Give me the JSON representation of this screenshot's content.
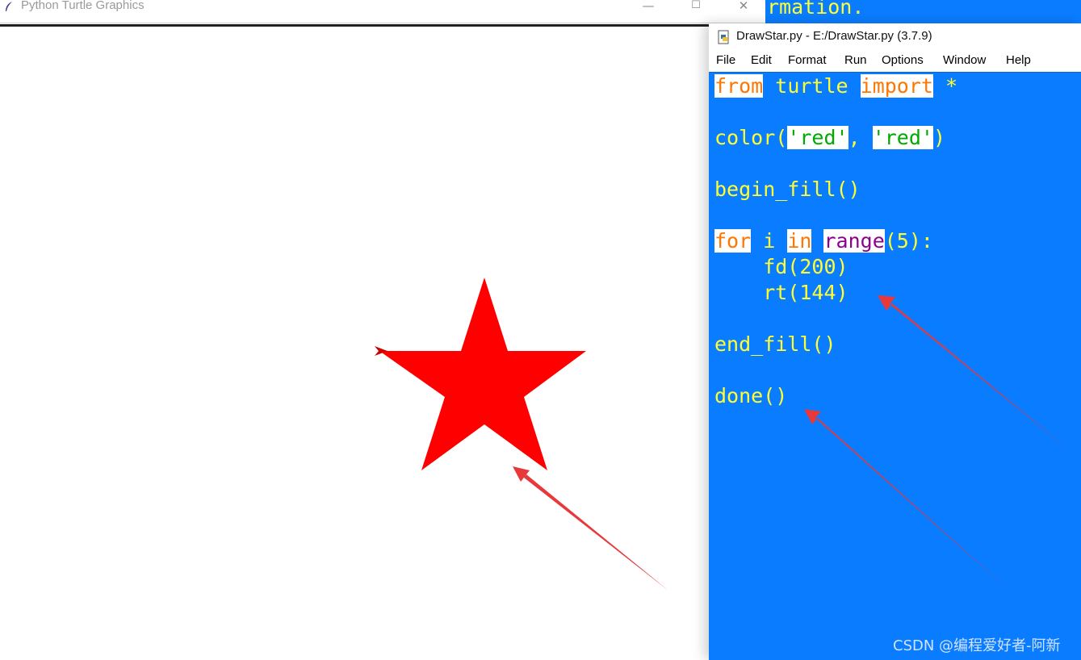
{
  "turtle_window": {
    "title": "Python Turtle Graphics",
    "minimize_symbol": "—",
    "maximize_symbol": "☐",
    "close_symbol": "✕",
    "star_fill_color": "#ff0000"
  },
  "shell_window": {
    "visible_text": "rmation."
  },
  "editor_window": {
    "title": "DrawStar.py - E:/DrawStar.py (3.7.9)",
    "menu": [
      "File",
      "Edit",
      "Format",
      "Run",
      "Options",
      "Window",
      "Help"
    ],
    "code": {
      "line1": {
        "kw_from": "from",
        "mid": " turtle ",
        "kw_import": "import",
        "rest": " *"
      },
      "line2": {
        "pre": "color(",
        "s1": "'red'",
        "comma": ", ",
        "s2": "'red'",
        "post": ")"
      },
      "line3": "begin_fill()",
      "line4": {
        "kw_for": "for",
        "sp1": " i ",
        "kw_in": "in",
        "sp2": " ",
        "bi_range": "range",
        "rest": "(5):"
      },
      "line5": "    fd(200)",
      "line6": "    rt(144)",
      "line7": "end_fill()",
      "line8": "done()"
    },
    "background_color": "#0a7cff",
    "code_color": "#ffff33"
  },
  "annotation_arrow_color": "#e8383a",
  "watermark": "CSDN @编程爱好者-阿新"
}
